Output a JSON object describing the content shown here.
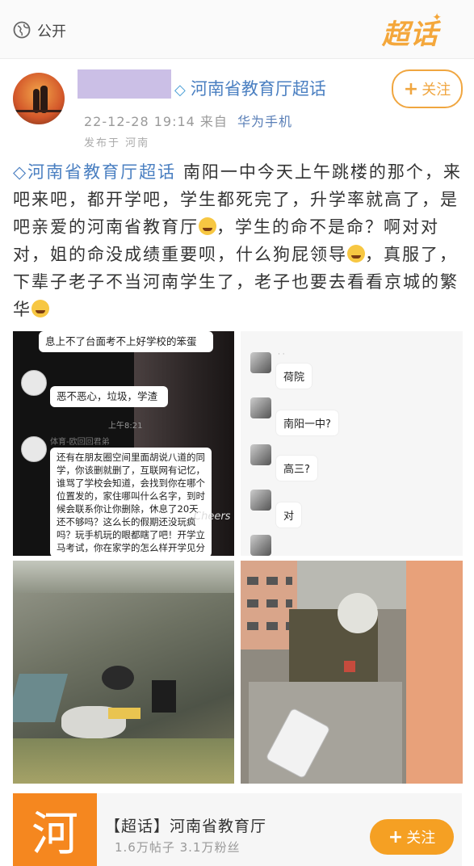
{
  "topbar": {
    "visibility": "公开",
    "logo": "超话",
    "icon": "globe-icon"
  },
  "post": {
    "supertopic": "河南省教育厅超话",
    "follow_label": "关注",
    "timestamp": "22-12-28 19:14",
    "source_prefix": "来自",
    "device": "华为手机",
    "location": "发布于 河南",
    "body_topic": "河南省教育厅超话",
    "body_parts": [
      "南阳一中今天上午跳楼的那个，来吧来吧，都开学吧，学生都死完了，升学率就高了，是吧亲爱的河南省教育厅",
      "，学生的命不是命？啊对对对，姐的命没成绩重要呗，什么狗屁领导",
      "，真服了，下辈子老子不当河南学生了，老子也要去看看京城的繁华"
    ]
  },
  "photo1": {
    "top_text": "息上不了台面考不上好学校的笨蛋",
    "bubble1": "恶不恶心，垃圾，学渣",
    "time": "上午8:21",
    "sender": "体育-欧回回君弟",
    "bubble2": "还有在朋友圈空间里面胡说八道的同学，你该删就删了，互联网有记忆，谁骂了学校会知道，会找到你在哪个位置发的，家住哪叫什么名字，到时候会联系你让你删除，休息了20天还不够吗？这么长的假期还没玩疯吗？玩手机玩的眼都瞎了吧！开学立马考试，你在家学的怎么样开学见分",
    "overlay": "Cheers"
  },
  "photo2": {
    "messages": [
      "荷院",
      "南阳一中?",
      "高三?",
      "对"
    ]
  },
  "footer_card": {
    "logo_char": "河",
    "title": "【超话】河南省教育厅",
    "stats": "1.6万帖子 3.1万粉丝",
    "follow_label": "关注"
  },
  "colors": {
    "accent_orange": "#f5a023",
    "link_blue": "#4a7fc1",
    "redaction": "#cbbfe6"
  }
}
